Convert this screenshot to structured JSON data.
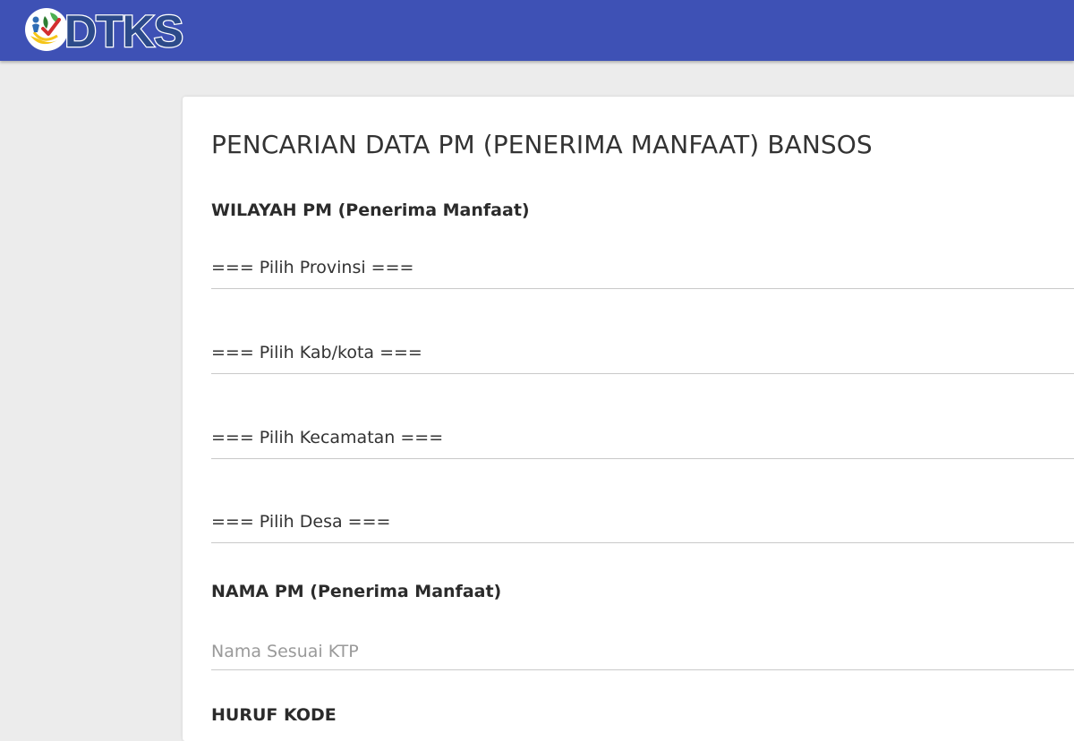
{
  "header": {
    "logo_text": "DTKS",
    "accent_color": "#3e51b5"
  },
  "form": {
    "title": "PENCARIAN DATA PM (PENERIMA MANFAAT) BANSOS",
    "wilayah_label": "WILAYAH PM (Penerima Manfaat)",
    "provinsi_select": "=== Pilih Provinsi ===",
    "kabkota_select": "=== Pilih Kab/kota ===",
    "kecamatan_select": "=== Pilih Kecamatan ===",
    "desa_select": "=== Pilih Desa ===",
    "nama_label": "NAMA PM (Penerima Manfaat)",
    "nama_placeholder": "Nama Sesuai KTP",
    "kode_label": "HURUF KODE"
  }
}
